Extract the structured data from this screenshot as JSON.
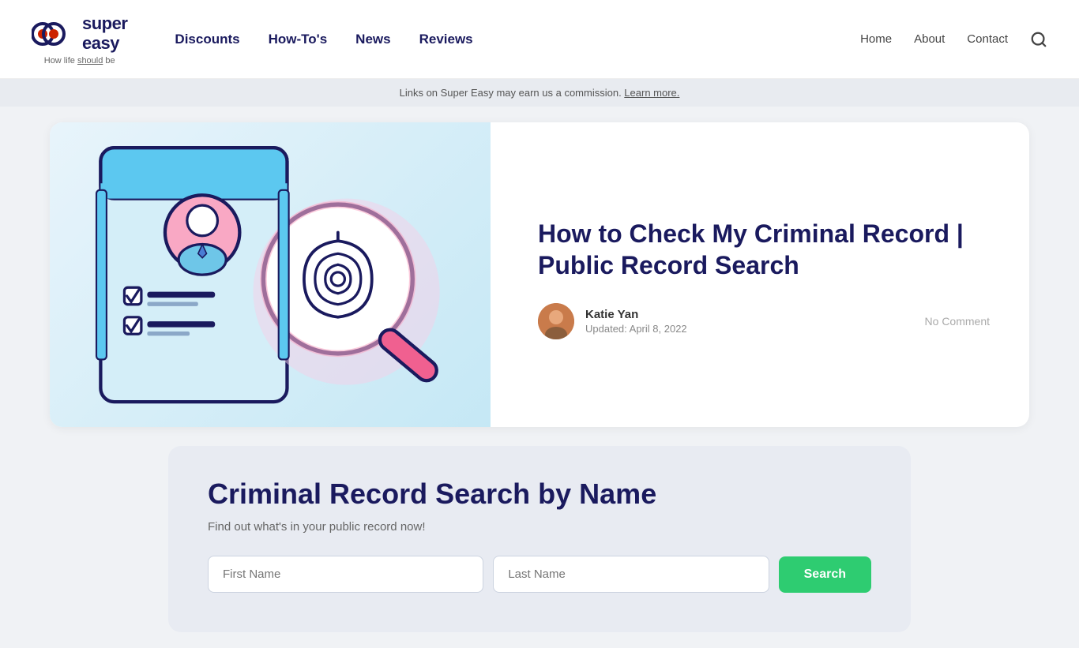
{
  "header": {
    "logo": {
      "super": "super",
      "easy": "easy",
      "tagline_pre": "How life ",
      "tagline_link": "should",
      "tagline_post": " be"
    },
    "nav": {
      "items": [
        {
          "label": "Discounts",
          "href": "#"
        },
        {
          "label": "How-To's",
          "href": "#"
        },
        {
          "label": "News",
          "href": "#"
        },
        {
          "label": "Reviews",
          "href": "#"
        }
      ]
    },
    "right_nav": {
      "items": [
        {
          "label": "Home",
          "href": "#"
        },
        {
          "label": "About",
          "href": "#"
        },
        {
          "label": "Contact",
          "href": "#"
        }
      ]
    },
    "search_icon": "🔍"
  },
  "commission_bar": {
    "text_pre": "Links on Super Easy may earn us a commission. ",
    "text_link": "Learn more."
  },
  "article": {
    "title": "How to Check My Criminal Record | Public Record Search",
    "author": {
      "name": "Katie Yan",
      "date": "Updated: April 8, 2022"
    },
    "comment_label": "No Comment"
  },
  "search_widget": {
    "title": "Criminal Record Search by Name",
    "subtitle": "Find out what's in your public record now!",
    "first_name_placeholder": "First Name",
    "last_name_placeholder": "Last Name",
    "button_label": "Search"
  }
}
